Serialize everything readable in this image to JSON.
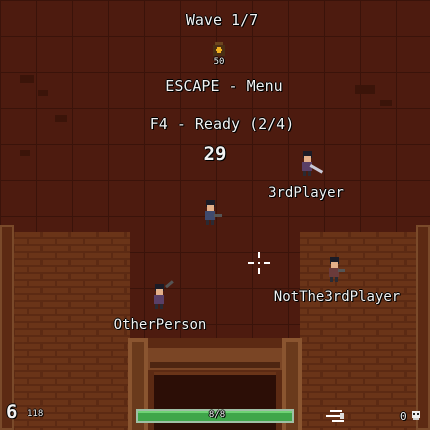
{
  "hud": {
    "wave": "Wave 1/7",
    "coins": "50",
    "menu_hint": "ESCAPE - Menu",
    "ready_status": "F4 - Ready (2/4)",
    "countdown": "29",
    "ammo": "6",
    "reserve_ammo": "118",
    "health_text": "8/8",
    "health_fraction": 1.0,
    "score": "0"
  },
  "players": [
    {
      "name": "3rdPlayer"
    },
    {
      "name": ""
    },
    {
      "name": "NotThe3rdPlayer"
    },
    {
      "name": "OtherPerson"
    }
  ],
  "icons": {
    "coin": "coin-bag-icon",
    "crosshair": "crosshair-icon",
    "dash": "dash-icon",
    "score": "skull-icon"
  },
  "colors": {
    "floor": "#4d1b0f",
    "brick": "#6a3418",
    "text": "#f2f2f2",
    "health": "#3fa64a"
  }
}
